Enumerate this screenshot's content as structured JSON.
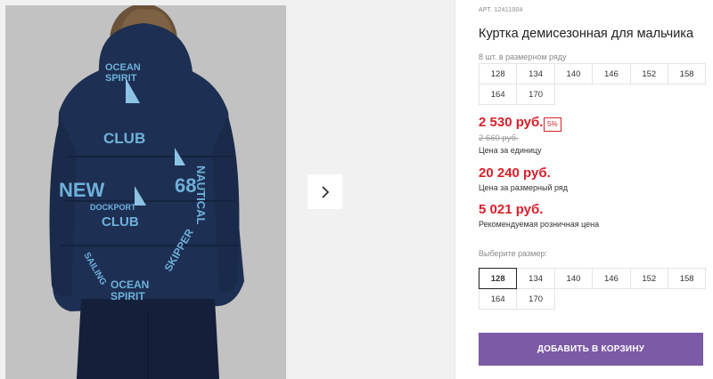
{
  "gallery": {
    "photo_alt": "child-in-jacket",
    "next_icon": "chevron-right-icon",
    "print_texts": [
      "OCEAN",
      "SPIRIT",
      "CLUB",
      "NEW",
      "NAUTICAL",
      "68",
      "SAILING",
      "DOCKPORT",
      "OCEAN",
      "SPIRIT",
      "CLUB",
      "SKIPPER"
    ]
  },
  "product": {
    "article": "АРТ. 12411004",
    "title": "Куртка демисезонная для мальчика",
    "size_note": "8 шт. в размерном ряду",
    "sizes_row": [
      "128",
      "134",
      "140",
      "146",
      "152",
      "158",
      "164",
      "170"
    ]
  },
  "prices": {
    "unit_price": "2 530 руб.",
    "discount": "5%",
    "old_price": "2 660 руб.",
    "unit_label": "Цена за единицу",
    "row_price": "20 240 руб.",
    "row_label": "Цена за размерный ряд",
    "retail_price": "5 021 руб.",
    "retail_label": "Рекомендуемая розничная цена"
  },
  "size_select": {
    "label": "Выберите размер:",
    "options": [
      "128",
      "134",
      "140",
      "146",
      "152",
      "158",
      "164",
      "170"
    ],
    "selected": "128"
  },
  "cart": {
    "button_label": "ДОБАВИТЬ В КОРЗИНУ",
    "button_color": "#7b5aa6"
  },
  "colors": {
    "price": "#d81f2a",
    "jacket": "#1d2f52",
    "print": "#6fb1da"
  }
}
